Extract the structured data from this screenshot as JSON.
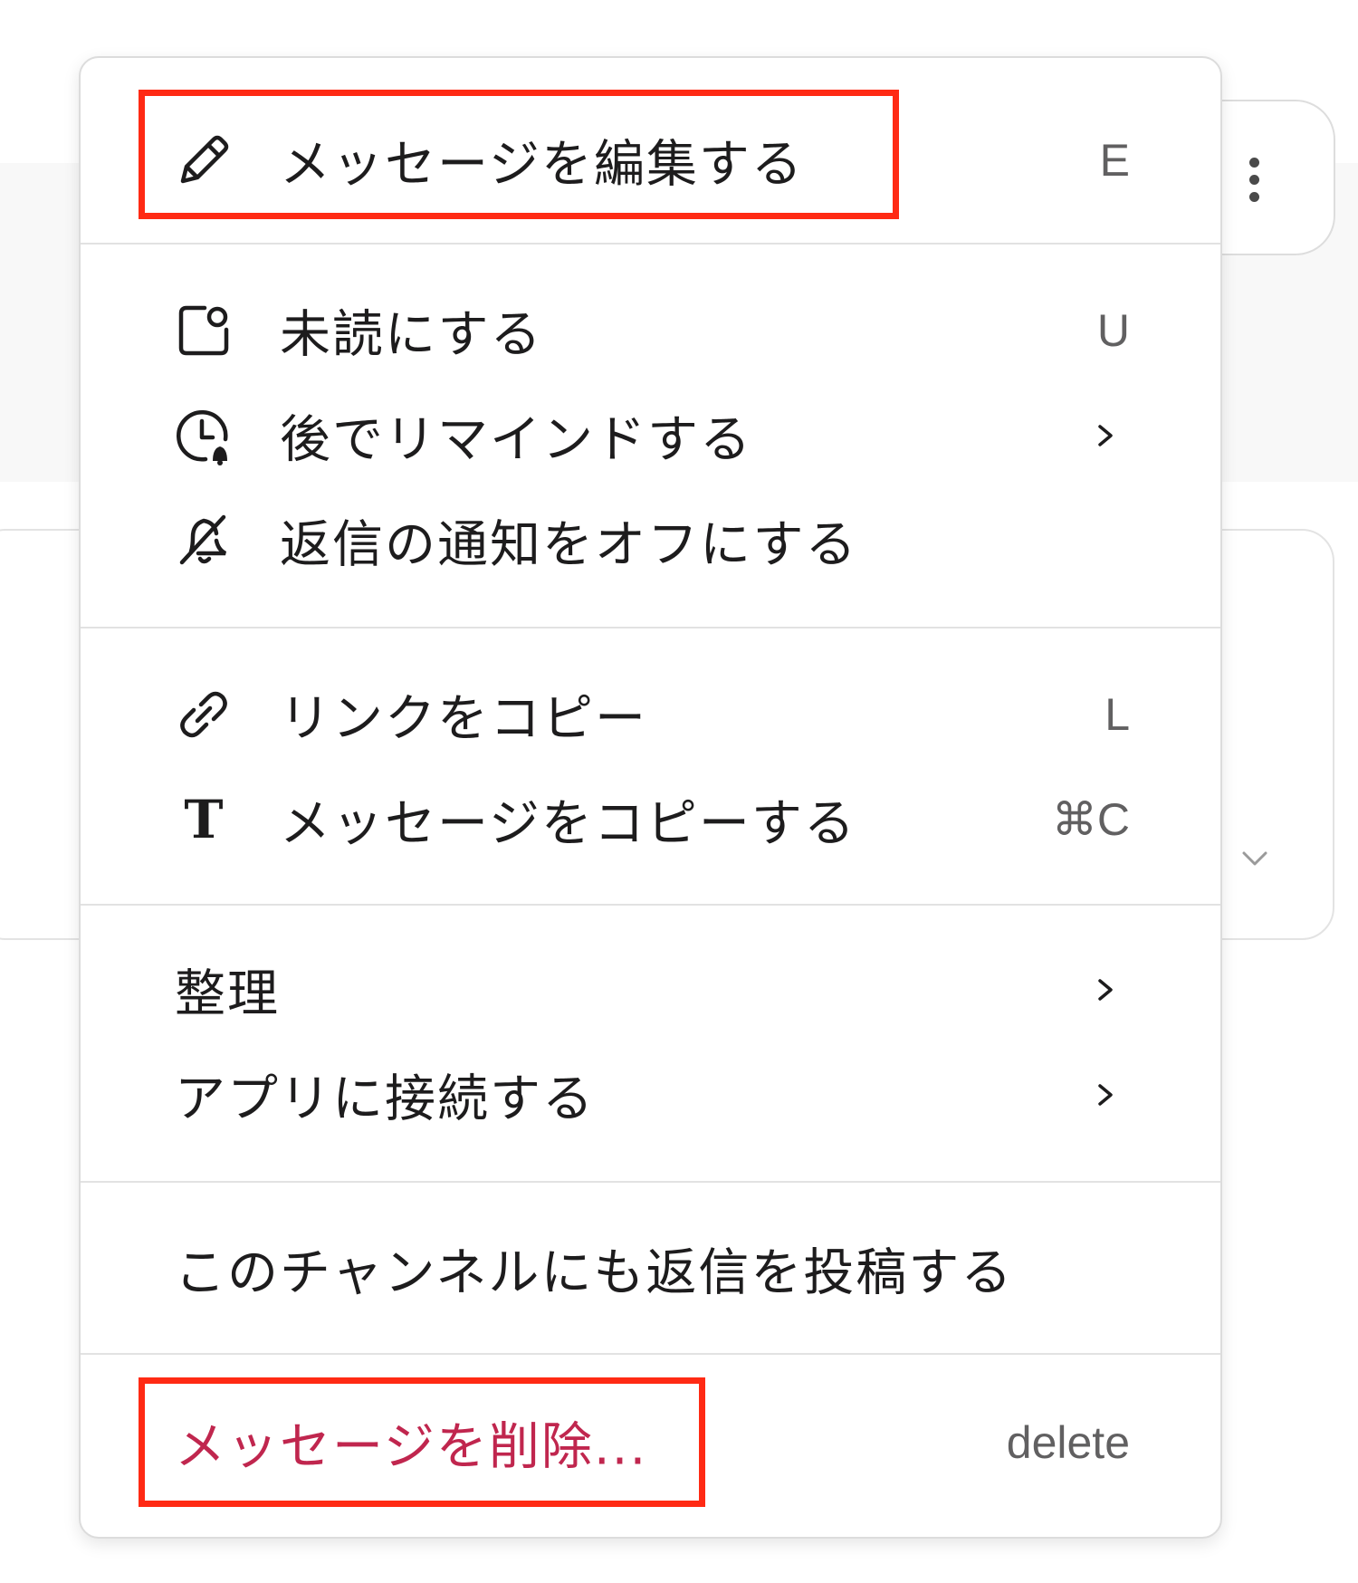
{
  "menu": {
    "edit": {
      "label": "メッセージを編集する",
      "shortcut": "E",
      "icon": "pencil-icon"
    },
    "mark_unread": {
      "label": "未読にする",
      "shortcut": "U",
      "icon": "mark-unread-icon"
    },
    "remind_later": {
      "label": "後でリマインドする",
      "icon": "clock-bell-icon",
      "has_submenu": true
    },
    "turn_off_notifications": {
      "label": "返信の通知をオフにする",
      "icon": "bell-off-icon"
    },
    "copy_link": {
      "label": "リンクをコピー",
      "shortcut": "L",
      "icon": "link-icon"
    },
    "copy_message": {
      "label": "メッセージをコピーする",
      "shortcut": "⌘C",
      "icon": "text-icon",
      "icon_glyph": "T"
    },
    "organize": {
      "label": "整理",
      "has_submenu": true
    },
    "connect_app": {
      "label": "アプリに接続する",
      "has_submenu": true
    },
    "also_send_to_channel": {
      "label": "このチャンネルにも返信を投稿する"
    },
    "delete": {
      "label": "メッセージを削除...",
      "shortcut": "delete"
    }
  },
  "highlight_color": "#ff2a14",
  "danger_color": "#c0264e"
}
